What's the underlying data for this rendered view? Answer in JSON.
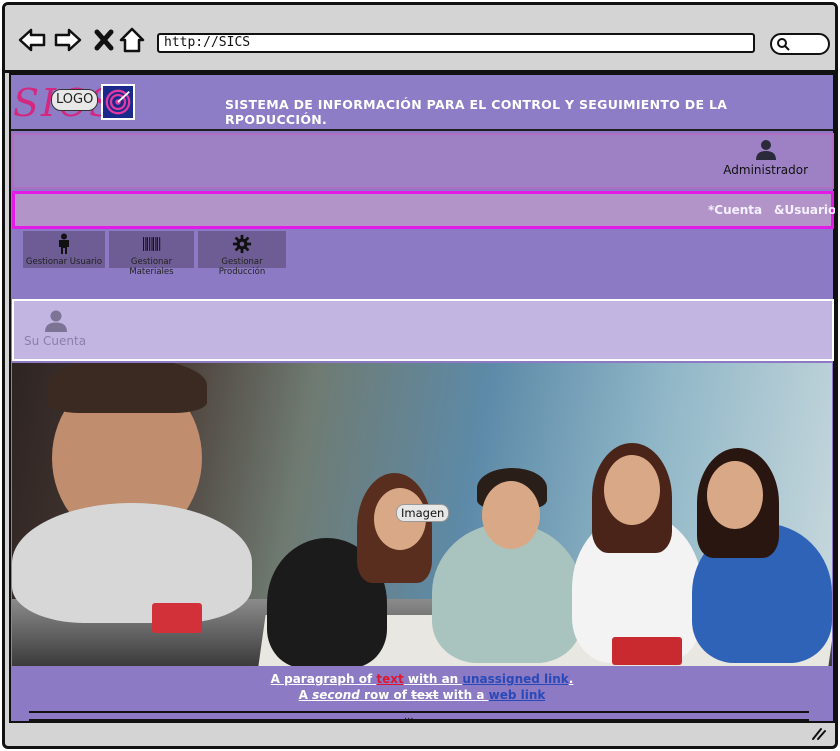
{
  "browser": {
    "url": "http://SICS",
    "back_icon": "arrow-left-icon",
    "forward_icon": "arrow-right-icon",
    "close_icon": "x-icon",
    "home_icon": "home-icon",
    "search_icon": "search-icon"
  },
  "header": {
    "brand": "SICS",
    "logo_label": "LOGO",
    "title": "SISTEMA DE INFORMACIÓN PARA EL CONTROL Y SEGUIMIENTO DE LA RPODUCCIÓN."
  },
  "userbar": {
    "user_label": "Administrador",
    "user_icon": "user-icon"
  },
  "menubar": {
    "cuenta": "*Cuenta",
    "usuario": "&Usuario"
  },
  "tiles": [
    {
      "label": "Gestionar Usuario",
      "icon": "person-icon"
    },
    {
      "label": "Gestionar Materiales",
      "icon": "barcode-icon"
    },
    {
      "label": "Gestionar Producción",
      "icon": "gear-icon"
    }
  ],
  "cuenta": {
    "label": "Su Cuenta",
    "icon": "user-icon"
  },
  "image": {
    "label": "Imagen"
  },
  "paragraph": {
    "line1_a": "A paragraph of ",
    "line1_text": "text",
    "line1_b": " with an ",
    "line1_link": "unassigned link",
    "line1_c": ".",
    "line2_a": "A ",
    "line2_second": "second",
    "line2_b": " row of ",
    "line2_text": "text",
    "line2_c": " with a ",
    "line2_link": "web link"
  },
  "footer": {
    "dots": "..."
  },
  "colors": {
    "page_bg": "#8c7bc4",
    "menubar_border": "#e21be6",
    "brand_pink": "#d42780",
    "link_blue": "#2a49b8",
    "text_red": "#e0152f"
  }
}
